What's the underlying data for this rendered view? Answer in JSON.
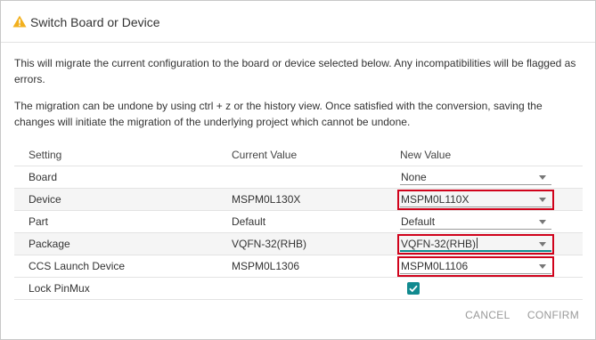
{
  "dialog": {
    "title": "Switch Board or Device",
    "icon": "warning-icon",
    "warning_color": "#f2b01e"
  },
  "description": {
    "p1": "This will migrate the current configuration to the board or device selected below. Any incompatibilities will be flagged as errors.",
    "p2": "The migration can be undone by using ctrl + z or the history view. Once satisfied with the conversion, saving the changes will initiate the migration of the underlying project which cannot be undone."
  },
  "table": {
    "headers": [
      "Setting",
      "Current Value",
      "New Value"
    ],
    "rows": [
      {
        "setting": "Board",
        "current": "",
        "new": "None"
      },
      {
        "setting": "Device",
        "current": "MSPM0L130X",
        "new": "MSPM0L110X"
      },
      {
        "setting": "Part",
        "current": "Default",
        "new": "Default"
      },
      {
        "setting": "Package",
        "current": "VQFN-32(RHB)",
        "new": "VQFN-32(RHB)"
      },
      {
        "setting": "CCS Launch Device",
        "current": "MSPM0L1306",
        "new": "MSPM0L1106"
      },
      {
        "setting": "Lock PinMux",
        "current": "",
        "new_checked": true
      }
    ]
  },
  "actions": {
    "cancel": "CANCEL",
    "confirm": "CONFIRM"
  },
  "colors": {
    "highlight": "#d0021b",
    "accent": "#118a8f"
  }
}
